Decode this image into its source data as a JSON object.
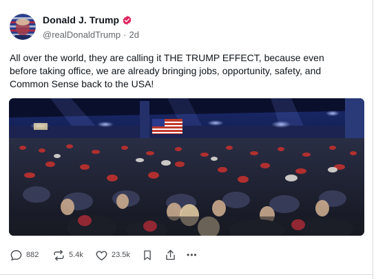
{
  "post": {
    "author": {
      "display_name": "Donald J. Trump",
      "handle": "@realDonaldTrump",
      "separator": "·",
      "time_ago": "2d",
      "verified_badge_color": "#e0245e"
    },
    "text": "All over the world, they are calling it THE TRUMP EFFECT, because even before taking office, we are already bringing jobs, opportunity, safety, and Common Sense back to the USA!",
    "actions": {
      "reply": {
        "icon": "comment-icon",
        "count": "882"
      },
      "repost": {
        "icon": "repost-icon",
        "count": "5.4k"
      },
      "like": {
        "icon": "heart-icon",
        "count": "23.5k"
      },
      "bookmark": {
        "icon": "bookmark-icon"
      },
      "share": {
        "icon": "share-icon"
      },
      "more": {
        "icon": "more-icon",
        "label": "•••"
      }
    }
  },
  "colors": {
    "text_primary": "#0f1419",
    "text_secondary": "#65676b",
    "icon_gray": "#4a4d52"
  }
}
